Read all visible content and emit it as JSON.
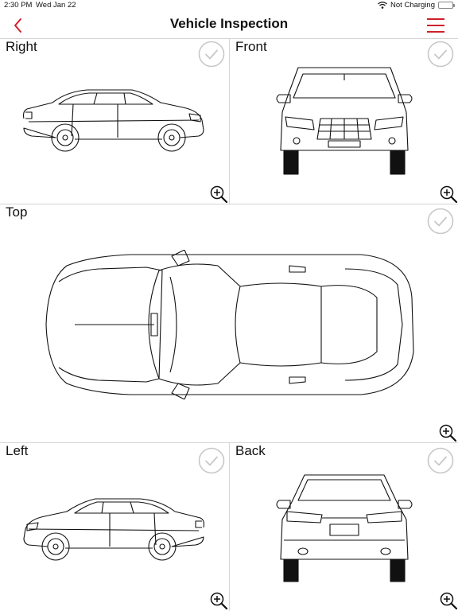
{
  "status_bar": {
    "time": "2:30 PM",
    "date": "Wed Jan 22",
    "charging": "Not Charging",
    "wifi_icon": "wifi-icon",
    "battery_icon": "battery-icon"
  },
  "header": {
    "title": "Vehicle Inspection",
    "back_icon": "chevron-left-icon",
    "menu_icon": "hamburger-menu-icon",
    "accent_color": "#d0202a"
  },
  "panels": {
    "right": {
      "label": "Right"
    },
    "front": {
      "label": "Front"
    },
    "top": {
      "label": "Top"
    },
    "left": {
      "label": "Left"
    },
    "back": {
      "label": "Back"
    }
  },
  "icons": {
    "check": "checkmark-circle-icon",
    "zoom": "zoom-in-icon"
  }
}
